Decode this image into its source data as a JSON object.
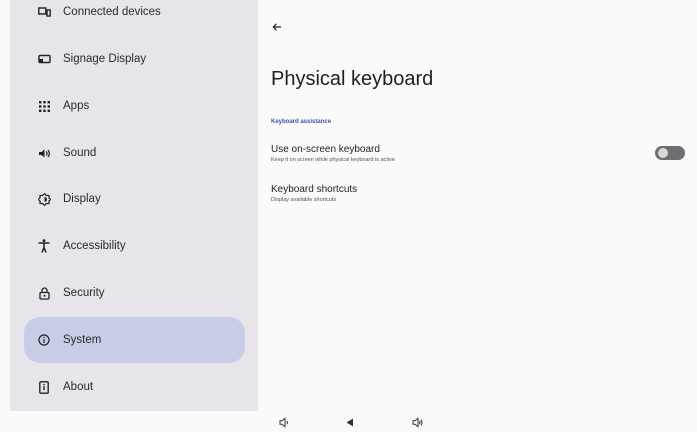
{
  "sidebar": {
    "items": [
      {
        "label": "Connected devices",
        "icon": "connected-devices-icon"
      },
      {
        "label": "Signage Display",
        "icon": "signage-display-icon"
      },
      {
        "label": "Apps",
        "icon": "apps-grid-icon"
      },
      {
        "label": "Sound",
        "icon": "speaker-icon"
      },
      {
        "label": "Display",
        "icon": "brightness-icon"
      },
      {
        "label": "Accessibility",
        "icon": "accessibility-icon"
      },
      {
        "label": "Security",
        "icon": "lock-icon"
      },
      {
        "label": "System",
        "icon": "info-icon",
        "active": true
      },
      {
        "label": "About",
        "icon": "device-info-icon"
      }
    ]
  },
  "main": {
    "title": "Physical keyboard",
    "section_header": "Keyboard assistance",
    "settings": [
      {
        "title": "Use on-screen keyboard",
        "summary": "Keep it on screen while physical keyboard is active",
        "toggle": "off"
      },
      {
        "title": "Keyboard shortcuts",
        "summary": "Display available shortcuts"
      }
    ]
  },
  "colors": {
    "active_item": "#c7cde6",
    "accent": "#3f51b5",
    "sidebar_bg": "#e8e5ea"
  },
  "navbar": {
    "icons": [
      "volume-down-icon",
      "back-triangle-icon",
      "volume-up-icon"
    ]
  }
}
